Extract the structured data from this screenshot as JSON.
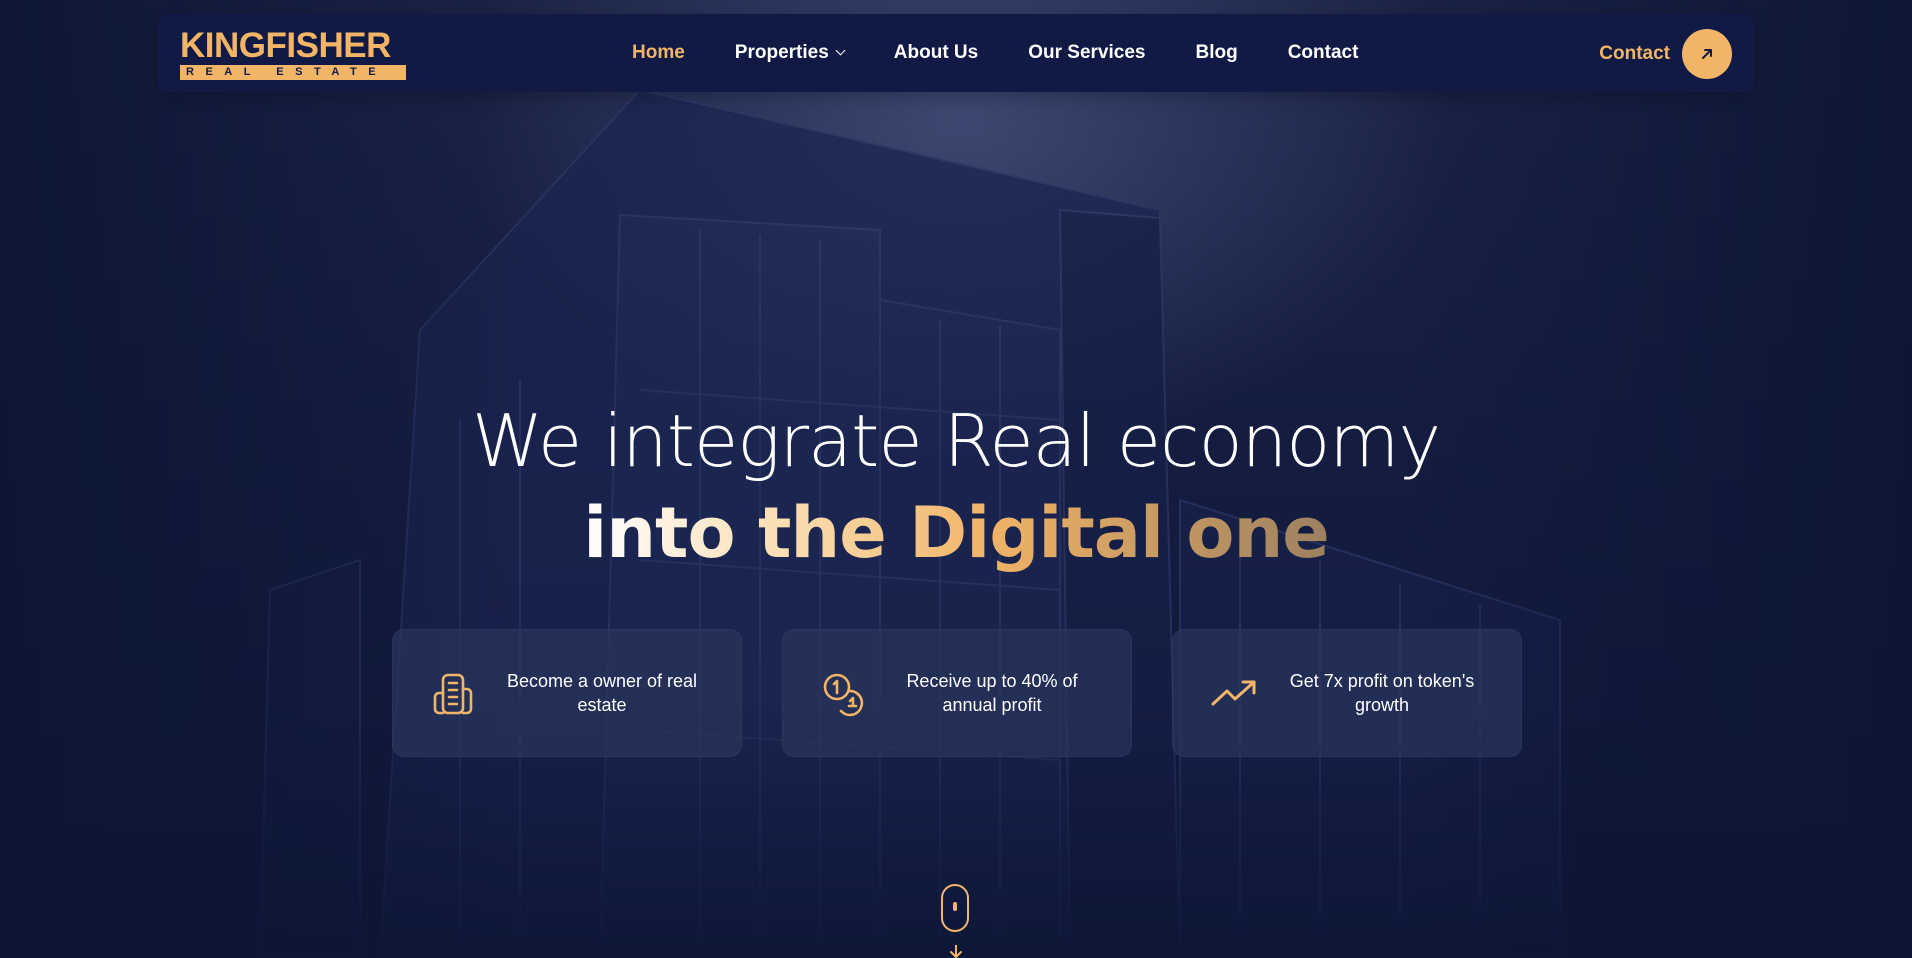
{
  "logo": {
    "top": "KINGFISHER",
    "bottom": "REAL ESTATE"
  },
  "nav": {
    "items": [
      {
        "label": "Home",
        "active": true
      },
      {
        "label": "Properties",
        "has_dropdown": true
      },
      {
        "label": "About Us"
      },
      {
        "label": "Our Services"
      },
      {
        "label": "Blog"
      },
      {
        "label": "Contact"
      }
    ],
    "cta_label": "Contact",
    "cta_icon": "arrow-up-right-icon"
  },
  "hero": {
    "line1": "We integrate Real economy",
    "line2": "into the Digital one"
  },
  "features": [
    {
      "icon": "building-icon",
      "text": "Become a owner of real estate"
    },
    {
      "icon": "coins-icon",
      "text": "Receive up to 40% of annual profit"
    },
    {
      "icon": "trending-up-icon",
      "text": "Get 7x profit on token's growth"
    }
  ],
  "scroll_indicator": {
    "icon": "mouse-scroll-icon"
  },
  "colors": {
    "accent": "#f2b567",
    "nav_background": "#101a44",
    "page_background": "#0d1636",
    "card_background": "#28345c"
  }
}
